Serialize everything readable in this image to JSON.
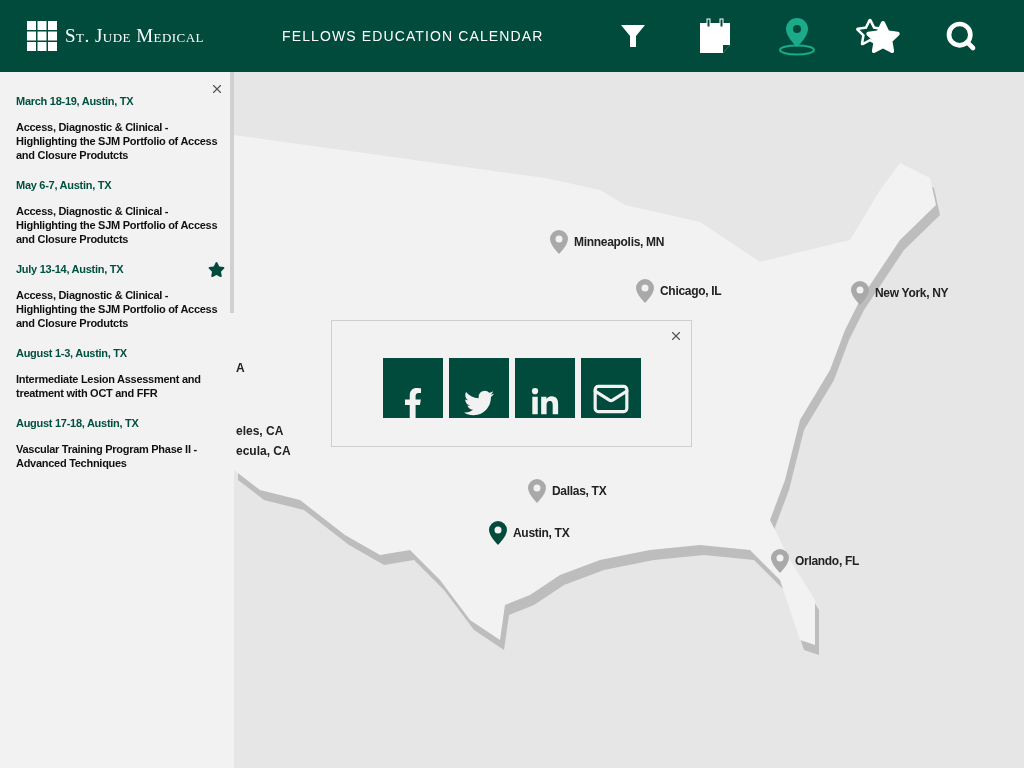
{
  "header": {
    "logo_text": "St. Jude Medical",
    "title": "FELLOWS EDUCATION CALENDAR",
    "nav": [
      {
        "kind": "filter",
        "selected": false
      },
      {
        "kind": "calendar",
        "selected": false
      },
      {
        "kind": "map",
        "selected": true
      },
      {
        "kind": "favorites",
        "selected": false
      },
      {
        "kind": "search",
        "selected": false
      }
    ]
  },
  "sidebar": {
    "events": [
      {
        "date": "March 18-19, Austin, TX",
        "title": "Access, Diagnostic & Clinical - Highlighting the SJM Portfolio of Access and Closure Produtcts",
        "starred": false
      },
      {
        "date": "May 6-7, Austin, TX",
        "title": "Access, Diagnostic & Clinical - Highlighting the SJM Portfolio of Access and Closure Produtcts",
        "starred": false
      },
      {
        "date": "July 13-14, Austin, TX",
        "title": "Access, Diagnostic & Clinical - Highlighting the SJM Portfolio of Access and Closure Produtcts",
        "starred": true
      },
      {
        "date": "August 1-3, Austin, TX",
        "title": "Intermediate Lesion Assessment and treatment with OCT and FFR",
        "starred": false
      },
      {
        "date": "August 17-18, Austin, TX",
        "title": "Vascular Training Program Phase II - Advanced Techniques",
        "starred": false
      }
    ]
  },
  "map": {
    "cities": [
      {
        "name": "Minneapolis, MN",
        "selected": false
      },
      {
        "name": "Chicago, IL",
        "selected": false
      },
      {
        "name": "New York, NY",
        "selected": false
      },
      {
        "name": "Dallas, TX",
        "selected": false
      },
      {
        "name": "Austin, TX",
        "selected": true
      },
      {
        "name": "Orlando, FL",
        "selected": false
      }
    ],
    "cut_labels": [
      "A",
      "eles, CA",
      "ecula, CA"
    ]
  },
  "share_popup": {
    "buttons": [
      {
        "kind": "facebook"
      },
      {
        "kind": "twitter"
      },
      {
        "kind": "linkedin"
      },
      {
        "kind": "email"
      }
    ]
  }
}
